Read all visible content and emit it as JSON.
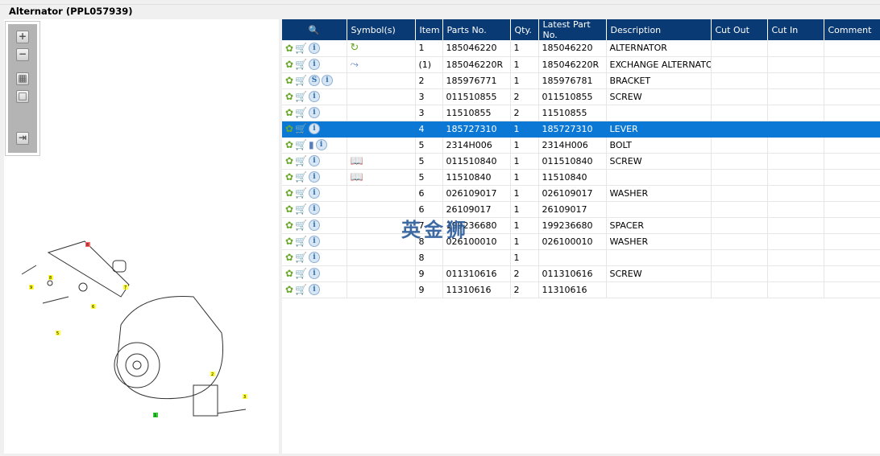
{
  "title": "Alternator (PPL057939)",
  "toolbar": {
    "zoom_in": "+",
    "zoom_out": "−",
    "fit": "▦",
    "frame": "□",
    "export": "⇥"
  },
  "table": {
    "headers": [
      "",
      "Symbol(s)",
      "Item",
      "Parts No.",
      "Qty.",
      "Latest Part No.",
      "Description",
      "Cut Out",
      "Cut In",
      "Comment"
    ],
    "rows": [
      {
        "icons": [
          "gears-icon",
          "cart-icon",
          "info-icon"
        ],
        "symbol": "rotate-icon",
        "item": "1",
        "part": "185046220",
        "qty": "1",
        "latest": "185046220",
        "desc": "ALTERNATOR"
      },
      {
        "icons": [
          "gear-icon",
          "cart-icon",
          "info-icon"
        ],
        "symbol": "exchange-icon",
        "item": "(1)",
        "part": "185046220R",
        "qty": "1",
        "latest": "185046220R",
        "desc": "EXCHANGE ALTERNATOR"
      },
      {
        "icons": [
          "gear-icon",
          "cart-icon",
          "s-icon",
          "info-icon"
        ],
        "symbol": "",
        "item": "2",
        "part": "185976771",
        "qty": "1",
        "latest": "185976781",
        "desc": "BRACKET"
      },
      {
        "icons": [
          "gear-icon",
          "cart-icon",
          "info-icon"
        ],
        "symbol": "",
        "item": "3",
        "part": "011510855",
        "qty": "2",
        "latest": "011510855",
        "desc": "SCREW"
      },
      {
        "icons": [
          "gear-icon",
          "cart-icon",
          "info-icon"
        ],
        "symbol": "",
        "item": "3",
        "part": "11510855",
        "qty": "2",
        "latest": "11510855",
        "desc": ""
      },
      {
        "icons": [
          "gear-icon",
          "cart-icon",
          "info-icon"
        ],
        "symbol": "",
        "item": "4",
        "part": "185727310",
        "qty": "1",
        "latest": "185727310",
        "desc": "LEVER",
        "selected": true
      },
      {
        "icons": [
          "gear-icon",
          "cart-icon",
          "book-icon",
          "info-icon"
        ],
        "symbol": "",
        "item": "5",
        "part": "2314H006",
        "qty": "1",
        "latest": "2314H006",
        "desc": "BOLT"
      },
      {
        "icons": [
          "gear-icon",
          "cart-icon",
          "info-icon"
        ],
        "symbol": "manual-icon",
        "item": "5",
        "part": "011510840",
        "qty": "1",
        "latest": "011510840",
        "desc": "SCREW"
      },
      {
        "icons": [
          "gear-icon",
          "cart-icon",
          "info-icon"
        ],
        "symbol": "manual-icon",
        "item": "5",
        "part": "11510840",
        "qty": "1",
        "latest": "11510840",
        "desc": ""
      },
      {
        "icons": [
          "gear-icon",
          "cart-icon",
          "info-icon"
        ],
        "symbol": "",
        "item": "6",
        "part": "026109017",
        "qty": "1",
        "latest": "026109017",
        "desc": "WASHER"
      },
      {
        "icons": [
          "gear-icon",
          "cart-icon",
          "info-icon"
        ],
        "symbol": "",
        "item": "6",
        "part": "26109017",
        "qty": "1",
        "latest": "26109017",
        "desc": ""
      },
      {
        "icons": [
          "gear-icon",
          "cart-icon",
          "info-icon"
        ],
        "symbol": "",
        "item": "7",
        "part": "199236680",
        "qty": "1",
        "latest": "199236680",
        "desc": "SPACER"
      },
      {
        "icons": [
          "gear-icon",
          "cart-icon",
          "info-icon"
        ],
        "symbol": "",
        "item": "8",
        "part": "026100010",
        "qty": "1",
        "latest": "026100010",
        "desc": "WASHER"
      },
      {
        "icons": [
          "gear-icon",
          "cart-icon",
          "info-icon"
        ],
        "symbol": "",
        "item": "8",
        "part": "",
        "qty": "1",
        "latest": "",
        "desc": ""
      },
      {
        "icons": [
          "gear-icon",
          "cart-icon",
          "info-icon"
        ],
        "symbol": "",
        "item": "9",
        "part": "011310616",
        "qty": "2",
        "latest": "011310616",
        "desc": "SCREW"
      },
      {
        "icons": [
          "gear-icon",
          "cart-icon",
          "info-icon"
        ],
        "symbol": "",
        "item": "9",
        "part": "11310616",
        "qty": "2",
        "latest": "11310616",
        "desc": ""
      }
    ]
  },
  "watermark": "英金狮",
  "callouts": [
    "1",
    "2",
    "3",
    "4",
    "5",
    "6",
    "7",
    "8",
    "9",
    "9",
    "8"
  ]
}
